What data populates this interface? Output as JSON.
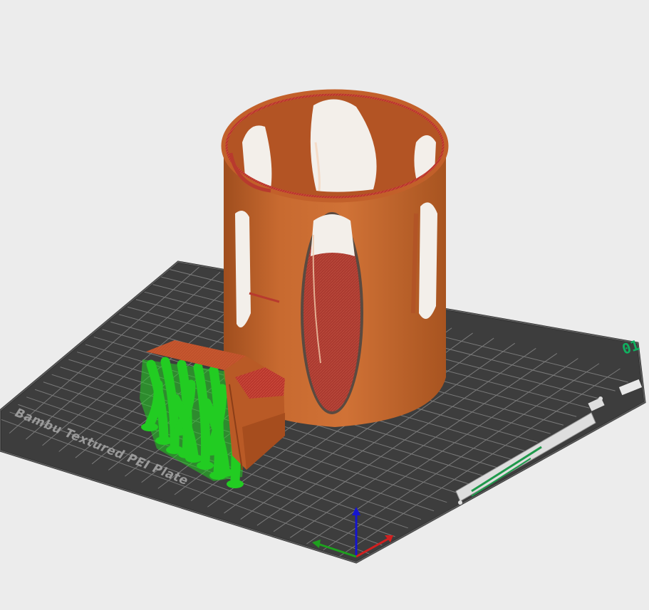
{
  "viewport": {
    "background": "#ececec"
  },
  "plate": {
    "name": "Bambu Textured PEI Plate",
    "number": "01",
    "colors": {
      "bed": "#3d3d3d",
      "grid": "#7a7a7a",
      "edge": "#262626",
      "label": "#9a9a9a",
      "number": "#11b060"
    }
  },
  "models": [
    {
      "name": "cylinder-holder",
      "color": "#c4632a",
      "wall_color": "#b83a2e"
    },
    {
      "name": "block-part",
      "color": "#c4632a"
    }
  ],
  "supports": {
    "color": "#22cc22"
  },
  "axes": {
    "x_color": "#d22020",
    "y_color": "#1ea01e",
    "z_color": "#1515d0"
  }
}
